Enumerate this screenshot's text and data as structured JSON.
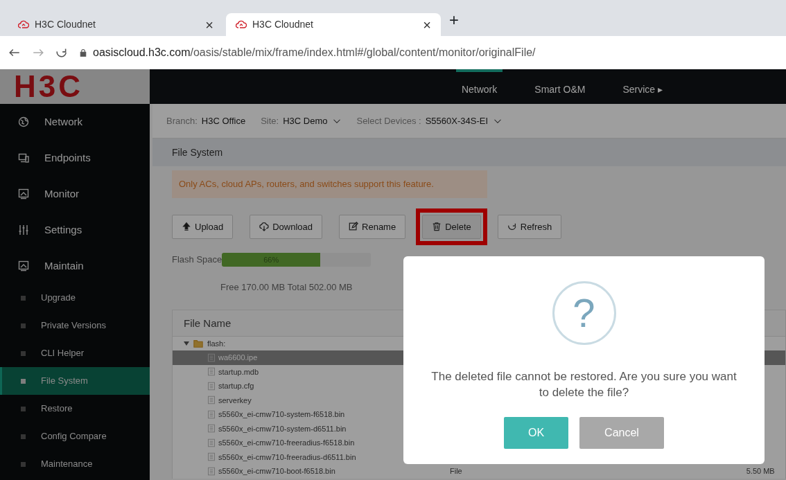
{
  "browser": {
    "tabs": [
      {
        "title": "H3C Cloudnet",
        "close": "×",
        "selected": false
      },
      {
        "title": "H3C Cloudnet",
        "close": "×",
        "selected": true
      }
    ],
    "new_tab": "+",
    "address": {
      "host": "oasiscloud.h3c.com",
      "path": "/oasis/stable/mix/frame/index.html#/global/content/monitor/originalFile/"
    }
  },
  "header": {
    "logo": "H3C",
    "nav": [
      {
        "label": "Network",
        "selected": true
      },
      {
        "label": "Smart O&M",
        "selected": false
      },
      {
        "label": "Service ▸",
        "selected": false
      }
    ]
  },
  "sidebar": {
    "items": [
      {
        "label": "Network",
        "kind": "globe",
        "selected": false
      },
      {
        "label": "Endpoints",
        "kind": "devices",
        "selected": false
      },
      {
        "label": "Monitor",
        "kind": "monitor",
        "selected": false
      },
      {
        "label": "Settings",
        "kind": "sliders",
        "selected": false
      },
      {
        "label": "Maintain",
        "kind": "monitor",
        "selected": false,
        "children": [
          {
            "label": "Upgrade",
            "selected": false
          },
          {
            "label": "Private Versions",
            "selected": false
          },
          {
            "label": "CLI Helper",
            "selected": false
          },
          {
            "label": "File System",
            "selected": true
          },
          {
            "label": "Restore",
            "selected": false
          },
          {
            "label": "Config Compare",
            "selected": false
          },
          {
            "label": "Maintenance",
            "selected": false
          }
        ]
      }
    ]
  },
  "filters": [
    {
      "label": "Branch:",
      "value": "H3C Office",
      "dropdown": false
    },
    {
      "label": "Site:",
      "value": "H3C Demo",
      "dropdown": true
    },
    {
      "label": "Select Devices :",
      "value": "S5560X-34S-EI",
      "dropdown": true
    }
  ],
  "page_title": "File System",
  "alert": "Only ACs, cloud APs, routers, and switches support this feature.",
  "toolbar": [
    {
      "label": "Upload",
      "kind": "upload",
      "highlighted": false
    },
    {
      "label": "Download",
      "kind": "download",
      "highlighted": false
    },
    {
      "label": "Rename",
      "kind": "edit",
      "highlighted": false
    },
    {
      "label": "Delete",
      "kind": "trash",
      "highlighted": true
    },
    {
      "label": "Refresh",
      "kind": "refresh",
      "highlighted": false
    }
  ],
  "flash": {
    "label": "Flash Space",
    "level": 0.66,
    "reading": "66%",
    "summary": "Free 170.00 MB Total 502.00 MB"
  },
  "table": {
    "columns": [
      "File Name"
    ],
    "root": {
      "label": "flash:",
      "expanded": true,
      "children": [
        {
          "name": "wa6600.ipe",
          "selected": true
        },
        {
          "name": "startup.mdb",
          "selected": false
        },
        {
          "name": "startup.cfg",
          "selected": false
        },
        {
          "name": "serverkey",
          "selected": false
        },
        {
          "name": "s5560x_ei-cmw710-system-f6518.bin",
          "selected": false
        },
        {
          "name": "s5560x_ei-cmw710-system-d6511.bin",
          "selected": false
        },
        {
          "name": "s5560x_ei-cmw710-freeradius-f6518.bin",
          "selected": false
        },
        {
          "name": "s5560x_ei-cmw710-freeradius-d6511.bin",
          "selected": false
        },
        {
          "name": "s5560x_ei-cmw710-boot-f6518.bin",
          "selected": false,
          "type": "File",
          "size": "5.50 MB"
        }
      ]
    }
  },
  "dialog": {
    "icon": "?",
    "message": "The deleted file cannot be restored. Are you sure you want to delete the file?",
    "buttons": [
      {
        "label": "OK",
        "kind": "primary"
      },
      {
        "label": "Cancel",
        "kind": "secondary"
      }
    ]
  }
}
